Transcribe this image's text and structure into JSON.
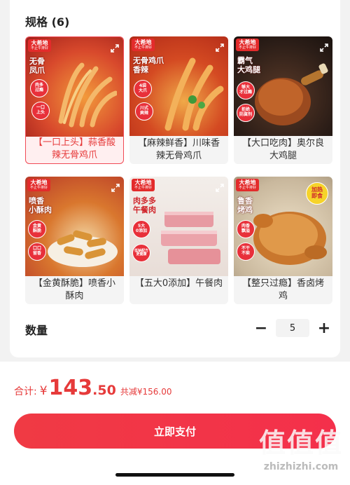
{
  "spec": {
    "title": "规格 (6)"
  },
  "brand": {
    "name": "大希地",
    "slogan": "不止牛排好"
  },
  "products": [
    {
      "label": "【一口上头】蒜香酸辣无骨鸡爪",
      "headline": "无骨\n凤爪",
      "tags": [
        "肉多\n过瘾",
        "一口\n上头"
      ],
      "selected": true,
      "tone": "#d8492c"
    },
    {
      "label": "【麻辣鲜香】川味香辣无骨鸡爪",
      "headline": "无骨鸡爪\n香辣",
      "tags": [
        "4袋\n大爪",
        "川式\n爽辣"
      ],
      "selected": false,
      "tone": "#c8391f"
    },
    {
      "label": "【大口吃肉】奥尔良大鸡腿",
      "headline": "霸气\n大鸡腿",
      "tags": [
        "够大\n才过瘾",
        "拒绝\n防腐剂"
      ],
      "selected": false,
      "tone": "#2b1d17"
    },
    {
      "label": "【金黄酥脆】喷香小酥肉",
      "headline": "喷香\n小酥肉",
      "tags": [
        "金黄\n酥脆",
        "口口\n留香"
      ],
      "selected": false,
      "tone": "#b73728"
    },
    {
      "label": "【五大0添加】午餐肉",
      "headline": "肉多多\n午餐肉",
      "tags": [
        "5大\n0添加",
        "低钠配方\n更健康"
      ],
      "selected": false,
      "tone": "#c8c0bc"
    },
    {
      "label": "【整只过瘾】香卤烤鸡",
      "headline": "鲁香\n烤鸡",
      "tags": [
        "肉香\n飘溢",
        "不干\n不柴",
        "加热\n即食"
      ],
      "selected": false,
      "tone": "#c9b89d"
    }
  ],
  "quantity": {
    "title": "数量",
    "minus": "−",
    "plus": "+",
    "value": "5"
  },
  "total": {
    "label": "合计:",
    "currency": "¥",
    "integer": "143",
    "decimal": ".50",
    "saving": "共减¥156.00"
  },
  "pay": {
    "label": "立即支付"
  },
  "watermark": {
    "mark": "值值值",
    "site": "zhizhizhi.com"
  },
  "colors": {
    "accent": "#e63a3a",
    "button": "#f03a44"
  }
}
